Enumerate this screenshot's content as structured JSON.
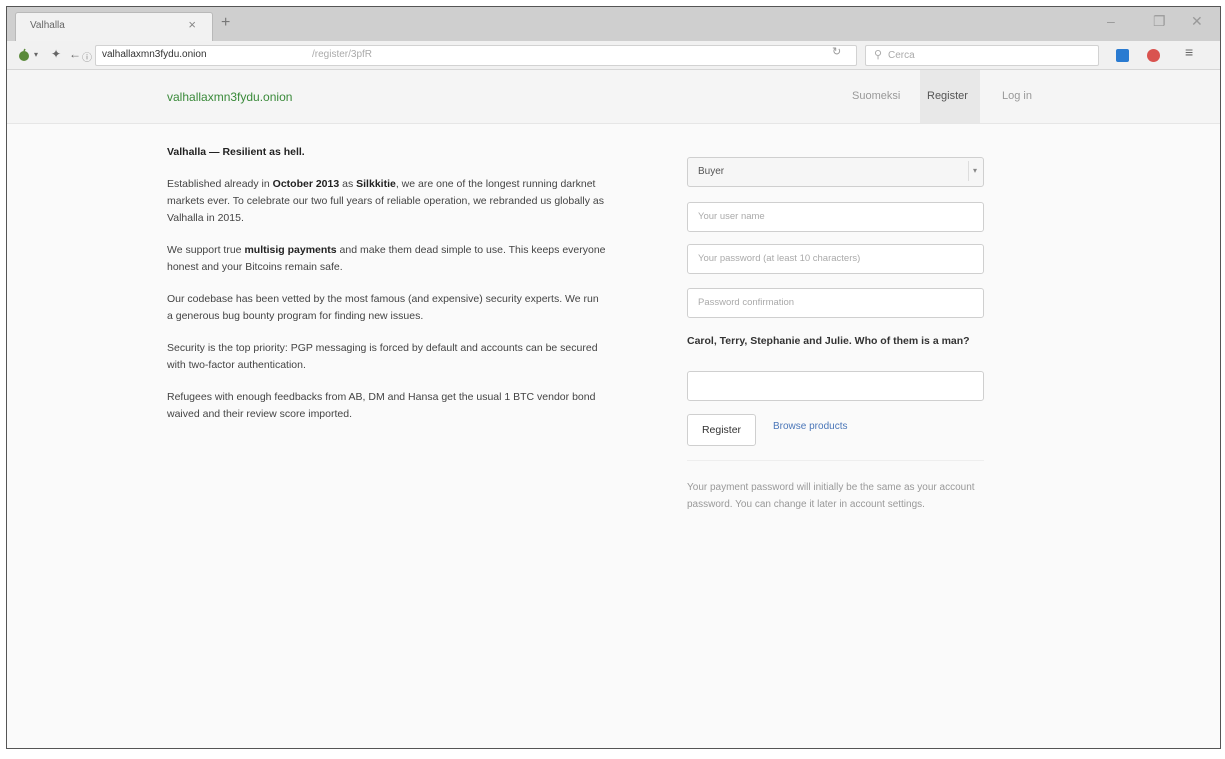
{
  "browser": {
    "tab_title": "Valhalla",
    "url_host": "valhallaxmn3fydu.onion",
    "url_path": "/register/3pfR",
    "search_placeholder": "Cerca",
    "close_glyph": "×",
    "new_tab_glyph": "+",
    "minimize_glyph": "–",
    "restore_glyph": "❐",
    "window_close_glyph": "✕"
  },
  "site": {
    "brand": "valhallaxmn3fydu.onion",
    "nav": {
      "suomeksi": "Suomeksi",
      "register": "Register",
      "login": "Log in"
    }
  },
  "intro": {
    "tagline_bold": "Valhalla — Resilient as hell.",
    "p1_a": "Established already in ",
    "p1_b": "October 2013",
    "p1_c": " as ",
    "p1_d": "Silkkitie",
    "p1_e": ", we are one of the longest running darknet markets ever. To celebrate our two full years of reliable operation, we rebranded us globally as Valhalla in 2015.",
    "p2_a": "We support true ",
    "p2_b": "multisig payments",
    "p2_c": " and make them dead simple to use. This keeps everyone honest and your Bitcoins remain safe.",
    "p3": "Our codebase has been vetted by the most famous (and expensive) security experts. We run a generous bug bounty program for finding new issues.",
    "p4": "Security is the top priority: PGP messaging is forced by default and accounts can be secured with two-factor authentication.",
    "p5": "Refugees with enough feedbacks from AB, DM and Hansa get the usual 1 BTC vendor bond waived and their review score imported."
  },
  "form": {
    "role_selected": "Buyer",
    "username_placeholder": "Your user name",
    "password_placeholder": "Your password (at least 10 characters)",
    "confirm_placeholder": "Password confirmation",
    "captcha_question": "Carol, Terry, Stephanie and Julie. Who of them is a man?",
    "captcha_value": "",
    "register_label": "Register",
    "browse_label": "Browse products",
    "note": "Your payment password will initially be the same as your account password. You can change it later in account settings."
  },
  "colors": {
    "brand_green": "#3a8a3a",
    "link_blue": "#4a76b8"
  }
}
